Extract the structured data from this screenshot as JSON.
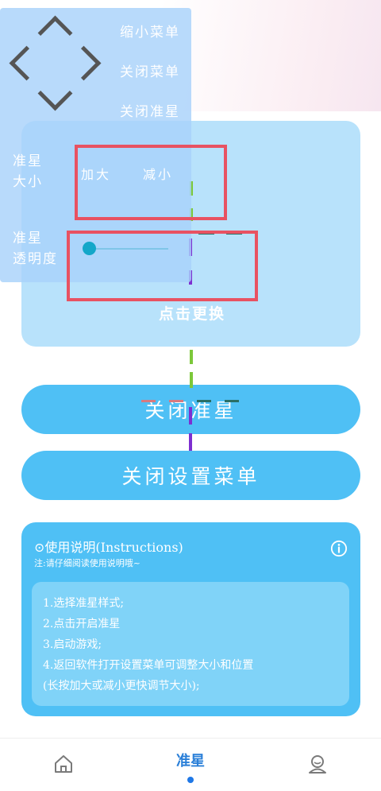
{
  "preview": {
    "change_label": "点击更换"
  },
  "buttons": {
    "close_crosshair": "关闭准星",
    "close_settings_menu": "关闭设置菜单"
  },
  "overlay_menu": {
    "shrink_menu": "缩小菜单",
    "close_menu": "关闭菜单",
    "close_crosshair": "关闭准星",
    "size_label_line1": "准星",
    "size_label_line2": "大小",
    "increase": "加大",
    "decrease": "减小",
    "opacity_label_line1": "准星",
    "opacity_label_line2": "透明度",
    "opacity_value": 0.0
  },
  "instructions": {
    "title": "⊙使用说明(Instructions)",
    "subtitle": "注:请仔细阅读使用说明哦~",
    "lines": [
      "1.选择准星样式;",
      "2.点击开启准星",
      "3.启动游戏;",
      "4.返回软件打开设置菜单可调整大小和位置",
      "(长按加大或减小更快调节大小);"
    ]
  },
  "nav": {
    "home_icon": "home-icon",
    "center_label": "准星",
    "profile_icon": "profile-icon"
  },
  "colors": {
    "accent_blue": "#4fc0f5",
    "highlight_red": "#e85262",
    "nav_active": "#2a7fd8"
  }
}
